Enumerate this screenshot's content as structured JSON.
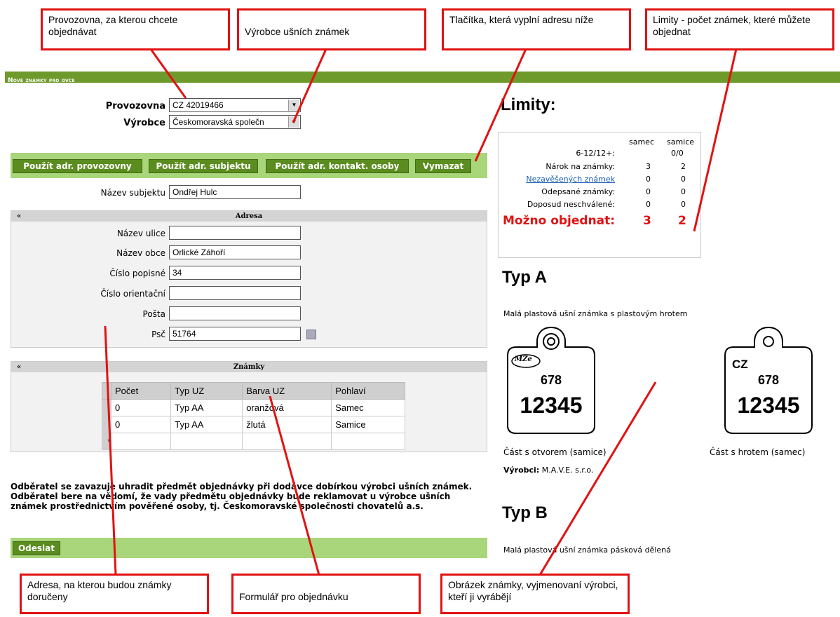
{
  "annotations": {
    "provozovna": "Provozovna, za kterou chcete objednávat",
    "vyrobce": "Výrobce ušních známek",
    "tlacitka": "Tlačítka, která vyplní adresu níže",
    "limity": "Limity - počet známek, které můžete objednat",
    "adresa": "Adresa, na kterou budou známky doručeny",
    "formular": "Formulář pro objednávku",
    "obrazek": "Obrázek známky, vyjmenovaní výrobci, kteří ji vyrábějí"
  },
  "header": {
    "title": "Nové známky pro ovce"
  },
  "form": {
    "provozovna_label": "Provozovna",
    "provozovna_value": "CZ 42019466",
    "vyrobce_label": "Výrobce",
    "vyrobce_value": "Českomoravská společn"
  },
  "buttons": {
    "use_prov": "Použít adr. provozovny",
    "use_subj": "Použít adr. subjektu",
    "use_contact": "Použít adr. kontakt. osoby",
    "clear": "Vymazat",
    "submit": "Odeslat"
  },
  "subject": {
    "label": "Název subjektu",
    "value": "Ondřej Hulc"
  },
  "address": {
    "title": "Adresa",
    "street_label": "Název ulice",
    "street": "",
    "city_label": "Název obce",
    "city": "Orlické Záhoří",
    "number_label": "Číslo popisné",
    "number": "34",
    "orient_label": "Číslo orientační",
    "orient": "",
    "post_label": "Pošta",
    "post": "",
    "zip_label": "Psč",
    "zip": "51764"
  },
  "tags_section": {
    "title": "Známky",
    "headers": [
      "Počet",
      "Typ UZ",
      "Barva UZ",
      "Pohlaví"
    ],
    "rows": [
      [
        "0",
        "Typ AA",
        "oranžová",
        "Samec"
      ],
      [
        "0",
        "Typ AA",
        "žlutá",
        "Samice"
      ]
    ],
    "new_row_marker": "*"
  },
  "notice": {
    "line1": "Odběratel se zavazuje uhradit předmět objednávky při dodávce dobírkou výrobci ušních známek.",
    "line2": "Odběratel bere na vědomí, že vady předmětu objednávky bude reklamovat u výrobce ušních",
    "line3": "známek prostřednictvím pověřené osoby, tj. Českomoravské společnosti chovatelů a.s."
  },
  "limits": {
    "title": "Limity:",
    "col_male": "samec",
    "col_female": "samice",
    "age_label": "6-12/12+:",
    "age_value": "0/0",
    "rows": [
      {
        "label": "Nárok na známky:",
        "male": "3",
        "female": "2",
        "link": false
      },
      {
        "label": "Nezavěšených známek",
        "male": "0",
        "female": "0",
        "link": true
      },
      {
        "label": "Odepsané známky:",
        "male": "0",
        "female": "0",
        "link": false
      },
      {
        "label": "Doposud neschválené:",
        "male": "0",
        "female": "0",
        "link": false
      }
    ],
    "can_order_label": "Možno objednat:",
    "can_order_male": "3",
    "can_order_female": "2"
  },
  "typeA": {
    "title": "Typ A",
    "desc": "Malá plastová ušní známka s plastovým hrotem",
    "tag1_logo": "MŽe",
    "tag1_num_small": "678",
    "tag1_num_big": "12345",
    "tag2_country": "CZ",
    "tag2_num_small": "678",
    "tag2_num_big": "12345",
    "caption1": "Část s otvorem (samice)",
    "caption2": "Část s hrotem (samec)",
    "maker_label": "Výrobci:",
    "maker_value": "M.A.V.E. s.r.o."
  },
  "typeB": {
    "title": "Typ B",
    "desc": "Malá plastová ušní známka pásková dělená"
  }
}
